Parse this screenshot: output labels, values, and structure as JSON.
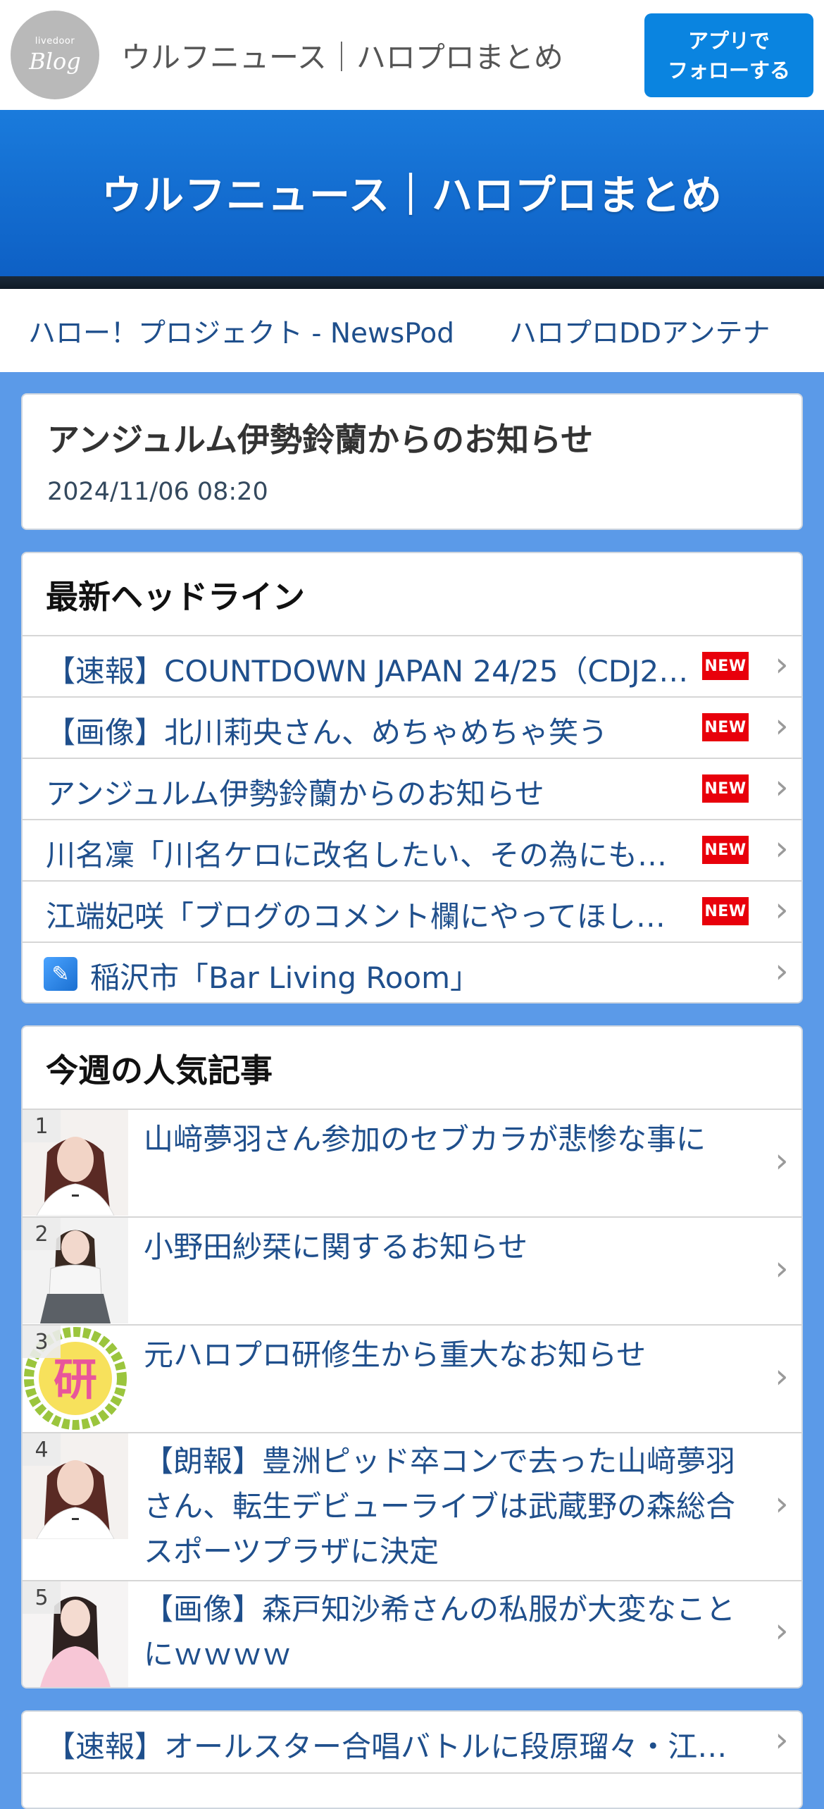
{
  "header": {
    "logo_small": "livedoor",
    "logo_big": "Blog",
    "site_title": "ウルフニュース｜ハロプロまとめ",
    "follow_line1": "アプリで",
    "follow_line2": "フォローする"
  },
  "banner": {
    "title": "ウルフニュース｜ハロプロまとめ"
  },
  "nav": {
    "links": [
      "ハロー！プロジェクト - NewsPod",
      "ハロプロDDアンテナ"
    ]
  },
  "article": {
    "title": "アンジュルム伊勢鈴蘭からのお知らせ",
    "date": "2024/11/06 08:20"
  },
  "headlines": {
    "heading": "最新ヘッドライン",
    "new_label": "NEW",
    "items": [
      {
        "text": "【速報】COUNTDOWN JAPAN 24/25（CDJ2…",
        "new": true
      },
      {
        "text": "【画像】北川莉央さん、めちゃめちゃ笑う",
        "new": true
      },
      {
        "text": "アンジュルム伊勢鈴蘭からのお知らせ",
        "new": true
      },
      {
        "text": "川名凜「川名ケロに改名したい、その為にもっ…",
        "new": true
      },
      {
        "text": "江端妃咲「ブログのコメント欄にやってほしい…",
        "new": true
      },
      {
        "text": "稲沢市「Bar Living Room」",
        "new": false
      }
    ]
  },
  "popular": {
    "heading": "今週の人気記事",
    "items": [
      {
        "rank": "1",
        "text": "山﨑夢羽さん参加のセブカラが悲惨な事に"
      },
      {
        "rank": "2",
        "text": "小野田紗栞に関するお知らせ"
      },
      {
        "rank": "3",
        "text": "元ハロプロ研修生から重大なお知らせ",
        "thumb_label": "研"
      },
      {
        "rank": "4",
        "text": "【朗報】豊洲ピッド卒コンで去った山﨑夢羽さん、転生デビューライブは武蔵野の森総合スポーツプラザに決定"
      },
      {
        "rank": "5",
        "text": "【画像】森戸知沙希さんの私服が大変なことにｗｗｗｗ"
      }
    ]
  },
  "bottom": {
    "items": [
      {
        "text": "【速報】オールスター合唱バトルに段原瑠々・江…"
      }
    ]
  },
  "icons": {
    "chevron": "chevron-right-icon",
    "feather": "feather-icon"
  },
  "colors": {
    "link": "#1f4f8c",
    "accent": "#0a84e0",
    "banner": "#1a7bdc",
    "page_bg": "#5b9ae8",
    "new_badge": "#e8000b"
  }
}
